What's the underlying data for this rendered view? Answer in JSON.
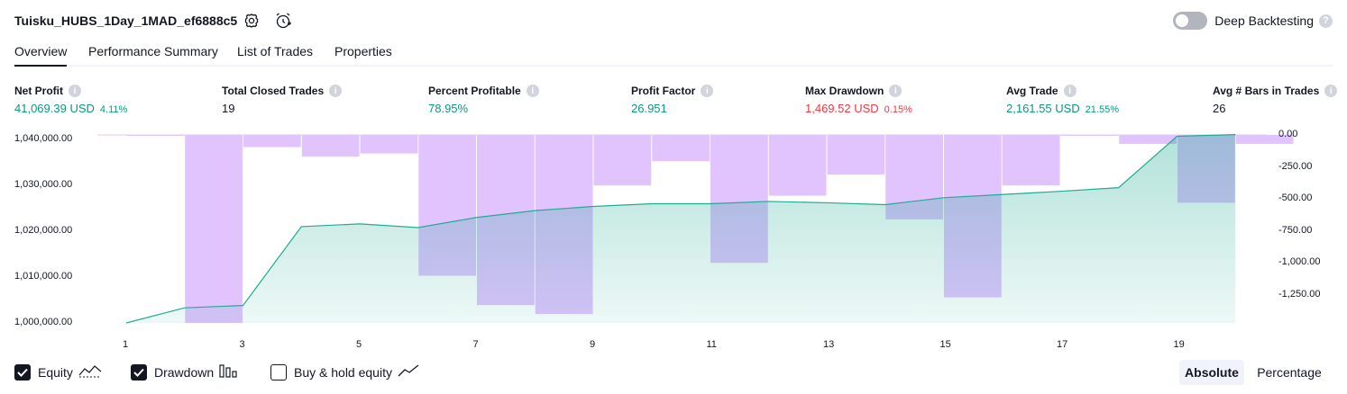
{
  "header": {
    "strategy_name": "Tuisku_HUBS_1Day_1MAD_ef6888c5",
    "settings_icon": "gear-icon",
    "alert_icon": "alarm-clock-plus-icon",
    "deep_backtesting_label": "Deep Backtesting",
    "deep_backtesting_on": false
  },
  "tabs": [
    {
      "label": "Overview",
      "active": true
    },
    {
      "label": "Performance Summary",
      "active": false
    },
    {
      "label": "List of Trades",
      "active": false
    },
    {
      "label": "Properties",
      "active": false
    }
  ],
  "metrics": [
    {
      "label": "Net Profit",
      "value": "41,069.39 USD",
      "pct": "4.11%",
      "color": "green"
    },
    {
      "label": "Total Closed Trades",
      "value": "19",
      "pct": "",
      "color": "black"
    },
    {
      "label": "Percent Profitable",
      "value": "78.95%",
      "pct": "",
      "color": "green"
    },
    {
      "label": "Profit Factor",
      "value": "26.951",
      "pct": "",
      "color": "green"
    },
    {
      "label": "Max Drawdown",
      "value": "1,469.52 USD",
      "pct": "0.15%",
      "color": "red"
    },
    {
      "label": "Avg Trade",
      "value": "2,161.55 USD",
      "pct": "21.55%",
      "color": "green"
    },
    {
      "label": "Avg # Bars in Trades",
      "value": "26",
      "pct": "",
      "color": "black"
    }
  ],
  "chart_data": {
    "type": "line+bar",
    "x": [
      1,
      2,
      3,
      4,
      5,
      6,
      7,
      8,
      9,
      10,
      11,
      12,
      13,
      14,
      15,
      16,
      17,
      18,
      19,
      20
    ],
    "x_tick_labels": [
      "1",
      "3",
      "5",
      "7",
      "9",
      "11",
      "13",
      "15",
      "17",
      "19"
    ],
    "series": [
      {
        "name": "Equity",
        "axis": "left",
        "kind": "area-line",
        "color": "#22ab94",
        "values": [
          1000000,
          1003300,
          1003800,
          1021000,
          1021600,
          1020800,
          1023000,
          1024500,
          1025400,
          1026000,
          1026000,
          1026500,
          1026200,
          1025800,
          1027300,
          1028000,
          1028700,
          1029500,
          1040700,
          1041069
        ]
      },
      {
        "name": "Drawdown",
        "axis": "right",
        "kind": "bar",
        "color": "#e1c3fe",
        "values": [
          -5,
          -1469.52,
          -95,
          -170,
          -145,
          -1100,
          -1330,
          -1400,
          -395,
          -205,
          -1000,
          -475,
          -310,
          -660,
          -1270,
          -395,
          -5,
          -70,
          -530,
          -70
        ]
      }
    ],
    "left_axis": {
      "ticks": [
        1000000,
        1010000,
        1020000,
        1030000,
        1040000
      ],
      "tick_labels": [
        "1,000,000.00",
        "1,010,000.00",
        "1,020,000.00",
        "1,030,000.00",
        "1,040,000.00"
      ],
      "range": [
        1000000,
        1041000
      ]
    },
    "right_axis": {
      "ticks": [
        0,
        -250,
        -500,
        -750,
        -1000,
        -1250
      ],
      "tick_labels": [
        "0.00",
        "-250.00",
        "-500.00",
        "-750.00",
        "-1,000.00",
        "-1,250.00"
      ],
      "range": [
        -1469.52,
        0
      ]
    },
    "grid": false
  },
  "legend": [
    {
      "label": "Equity",
      "checked": true,
      "icon": "equity-line-icon"
    },
    {
      "label": "Drawdown",
      "checked": true,
      "icon": "drawdown-bars-icon"
    },
    {
      "label": "Buy & hold equity",
      "checked": false,
      "icon": "buy-hold-line-icon"
    }
  ],
  "scale_toggle": {
    "absolute_label": "Absolute",
    "percentage_label": "Percentage",
    "selected": "Absolute"
  },
  "colors": {
    "green": "#089981",
    "red": "#f23645",
    "equity_line": "#22ab94",
    "drawdown_bar": "#e1c3fe"
  }
}
